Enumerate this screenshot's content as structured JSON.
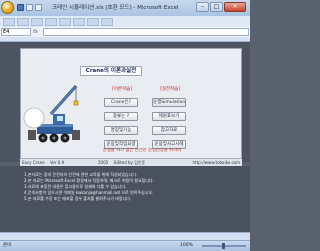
{
  "window": {
    "title": "크레인 시뮬레이션.xls [호환 모드] - Microsoft Excel",
    "controls": [
      "–",
      "□",
      "×"
    ]
  },
  "formula_bar": {
    "cell_ref": "E4",
    "fx": "fx",
    "value": ""
  },
  "app": {
    "title": "Crane의 이론과실전",
    "theory_header": "[이론학습]",
    "practice_header": "[실전학습]",
    "theory_buttons": [
      "Crane은?",
      "종류는 ?",
      "명칭및기능",
      "운용및작업요령"
    ],
    "practice_buttons": [
      "운행Simulation",
      "제원표보기",
      "참고자료",
      "운용및사고사례"
    ],
    "warning": "운행을 사고 없는 안전한 산업현장을 위하여",
    "footer": {
      "app_name": "Easy Crane",
      "version": "Ver 0.9",
      "year": "2005",
      "author": "Edited by 김인준",
      "url": "http://www.tobaiko.com"
    }
  },
  "notes": [
    "1.본자료는 장비 운전자의 안전에 관한 교육을 위해 작성되었습니다.",
    "2.본 자료는 Microsoft Excel 환경에서 작동하며, 매크로 허용이 필요합니다.",
    "3.자료에 포함된 내용은 참고용으로 실제와 다를 수 있습니다.",
    "4.문의사항이 있으시면 이메일 kwkanja@hanmail.net 으로 연락주십시오.",
    "5.본 자료를 수정 또는 배포할 경우 출처를 밝혀주시기 바랍니다."
  ],
  "status": {
    "text": "준비",
    "zoom": "100%",
    "zoom_fraction": 0.5
  },
  "colors": {
    "warning_red": "#c0282a",
    "header_red": "#c01b1b",
    "title_navy": "#1b2d55"
  }
}
